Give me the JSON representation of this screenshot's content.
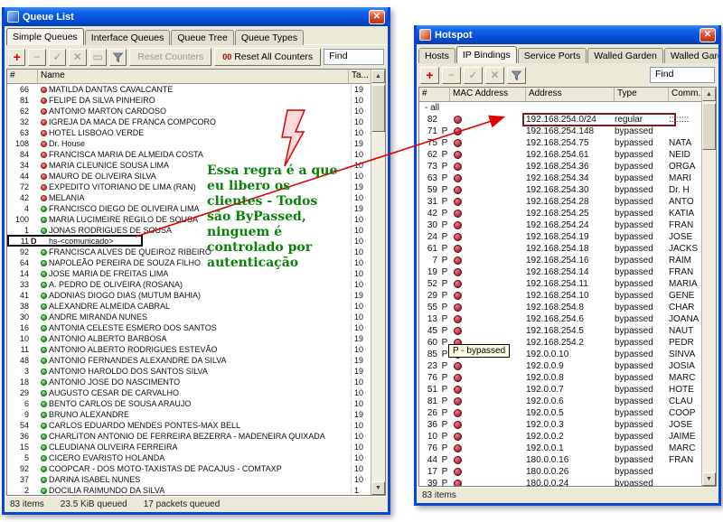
{
  "queue_window": {
    "title": "Queue List",
    "tabs": [
      "Simple Queues",
      "Interface Queues",
      "Queue Tree",
      "Queue Types"
    ],
    "active_tab": 0,
    "toolbar": {
      "reset_counters": "Reset Counters",
      "reset_all_prefix": "00",
      "reset_all": "Reset All Counters",
      "find": "Find"
    },
    "columns": [
      "#",
      "Name",
      "Ta..."
    ],
    "rows": [
      {
        "num": "66",
        "icon": "red",
        "name": "MATILDA DANTAS CAVALCANTE",
        "ta": "19"
      },
      {
        "num": "81",
        "icon": "red",
        "name": "FELIPE DA SILVA PINHEIRO",
        "ta": "10"
      },
      {
        "num": "62",
        "icon": "red",
        "name": "ANTONIO MARTON CARDOSO",
        "ta": "10"
      },
      {
        "num": "32",
        "icon": "red",
        "name": "IGREJA DA MACA DE FRANCA COMPCORO",
        "ta": "10"
      },
      {
        "num": "63",
        "icon": "red",
        "name": "HOTEL LISBOAO VERDE",
        "ta": "10"
      },
      {
        "num": "108",
        "icon": "red",
        "name": "Dr. House",
        "ta": "19"
      },
      {
        "num": "84",
        "icon": "red",
        "name": "FRANCISCA MARIA DE ALMEIDA COSTA",
        "ta": "10"
      },
      {
        "num": "34",
        "icon": "red",
        "name": "MARIA CLEUNICE SOUSA LIMA",
        "ta": "10"
      },
      {
        "num": "44",
        "icon": "red",
        "name": "MAURO DE OLIVEIRA SILVA",
        "ta": "10"
      },
      {
        "num": "72",
        "icon": "red",
        "name": "EXPEDITO VITORIANO DE LIMA (RAN)",
        "ta": "19"
      },
      {
        "num": "42",
        "icon": "red",
        "name": "MELANIA",
        "ta": "10"
      },
      {
        "num": "4",
        "icon": "green",
        "name": "FRANCISCO DIEGO DE OLIVEIRA LIMA",
        "ta": "19"
      },
      {
        "num": "100",
        "icon": "green",
        "name": "MARIA LUCIMEIRE REGILO DE SOUSA",
        "ta": "10"
      },
      {
        "num": "1",
        "icon": "green",
        "name": "JONAS RODRIGUES DE SOUSA",
        "ta": "10"
      },
      {
        "num": "11",
        "flag": "D",
        "name": "hs-<comunicado>",
        "ta": "10",
        "boxed": true
      },
      {
        "num": "92",
        "icon": "green",
        "name": "FRANCISCA ALVES DE QUEIROZ RIBEIRO",
        "ta": "10"
      },
      {
        "num": "64",
        "icon": "green",
        "name": "NAPOLEÃO PEREIRA DE SOUZA FILHO",
        "ta": "10"
      },
      {
        "num": "14",
        "icon": "green",
        "name": "JOSE MARIA DE FREITAS LIMA",
        "ta": "10"
      },
      {
        "num": "33",
        "icon": "green",
        "name": "A. PEDRO DE OLIVEIRA (ROSANA)",
        "ta": "10"
      },
      {
        "num": "41",
        "icon": "green",
        "name": "ADONIAS DIOGO DIAS (MUTUM BAHIA)",
        "ta": "19"
      },
      {
        "num": "38",
        "icon": "green",
        "name": "ALEXANDRE ALMEIDA CABRAL",
        "ta": "10"
      },
      {
        "num": "30",
        "icon": "green",
        "name": "ANDRE MIRANDA NUNES",
        "ta": "10"
      },
      {
        "num": "16",
        "icon": "green",
        "name": "ANTONIA CELESTE ESMERO DOS SANTOS",
        "ta": "10"
      },
      {
        "num": "10",
        "icon": "green",
        "name": "ANTONIO ALBERTO BARBOSA",
        "ta": "19"
      },
      {
        "num": "11",
        "icon": "green",
        "name": "ANTONIO ALBERTO RODRIGUES ESTEVÃO",
        "ta": "10"
      },
      {
        "num": "48",
        "icon": "green",
        "name": "ANTONIO FERNANDES ALEXANDRE DA SILVA",
        "ta": "19"
      },
      {
        "num": "3",
        "icon": "green",
        "name": "ANTONIO HAROLDO DOS SANTOS SILVA",
        "ta": "19"
      },
      {
        "num": "18",
        "icon": "green",
        "name": "ANTONIO JOSE DO NASCIMENTO",
        "ta": "10"
      },
      {
        "num": "29",
        "icon": "green",
        "name": "AUGUSTO CESAR DE CARVALHO",
        "ta": "10"
      },
      {
        "num": "6",
        "icon": "green",
        "name": "BENTO CARLOS DE SOUSA ARAUJO",
        "ta": "10"
      },
      {
        "num": "9",
        "icon": "green",
        "name": "BRUNO ALEXANDRE",
        "ta": "19"
      },
      {
        "num": "54",
        "icon": "green",
        "name": "CARLOS EDUARDO MENDES PONTES-MAX BELL",
        "ta": "10"
      },
      {
        "num": "36",
        "icon": "green",
        "name": "CHARLITON ANTONIO DE FERREIRA BEZERRA - MADENEIRA QUIXADA",
        "ta": "10"
      },
      {
        "num": "15",
        "icon": "green",
        "name": "CLEUDIANA OLIVEIRA FERREIRA",
        "ta": "10"
      },
      {
        "num": "5",
        "icon": "green",
        "name": "CICERO EVARISTO HOLANDA",
        "ta": "10"
      },
      {
        "num": "92",
        "icon": "green",
        "name": "COOPCAR - DOS MOTO-TAXISTAS DE PACAJUS - COMTAXP",
        "ta": "10"
      },
      {
        "num": "37",
        "icon": "green",
        "name": "DARINA ISABEL NUNES",
        "ta": "10"
      },
      {
        "num": "2",
        "icon": "green",
        "name": "DOCILIA RAIMUNDO DA SILVA",
        "ta": "1"
      }
    ],
    "status": [
      "83 items",
      "23.5 KiB queued",
      "17 packets queued"
    ]
  },
  "hotspot_window": {
    "title": "Hotspot",
    "tabs": [
      "Hosts",
      "IP Bindings",
      "Service Ports",
      "Walled Garden",
      "Walled Garden IP List"
    ],
    "active_tab": 1,
    "toolbar": {
      "find": "Find"
    },
    "columns": [
      "#",
      "MAC Address",
      "Address",
      "Type",
      "Comm..."
    ],
    "rows": [
      {
        "group": "all"
      },
      {
        "num": "82",
        "flag": "",
        "addr": "192.168.254.0/24",
        "type": "regular",
        "comment": "::::::::",
        "highlight": true
      },
      {
        "num": "71",
        "flag": "P",
        "addr": "192.168.254.148",
        "type": "bypassed",
        "comment": ""
      },
      {
        "num": "75",
        "flag": "P",
        "addr": "192.168.254.75",
        "type": "bypassed",
        "comment": "NATA"
      },
      {
        "num": "62",
        "flag": "P",
        "addr": "192.168.254.61",
        "type": "bypassed",
        "comment": "NEID"
      },
      {
        "num": "73",
        "flag": "P",
        "addr": "192.168.254.36",
        "type": "bypassed",
        "comment": "ORGA"
      },
      {
        "num": "63",
        "flag": "P",
        "addr": "192.168.254.34",
        "type": "bypassed",
        "comment": "MARI"
      },
      {
        "num": "59",
        "flag": "P",
        "addr": "192.168.254.30",
        "type": "bypassed",
        "comment": "Dr. H"
      },
      {
        "num": "31",
        "flag": "P",
        "addr": "192.168.254.28",
        "type": "bypassed",
        "comment": "ANTO"
      },
      {
        "num": "42",
        "flag": "P",
        "addr": "192.168.254.25",
        "type": "bypassed",
        "comment": "KATIA"
      },
      {
        "num": "30",
        "flag": "P",
        "addr": "192.168.254.24",
        "type": "bypassed",
        "comment": "FRAN"
      },
      {
        "num": "24",
        "flag": "P",
        "addr": "192.168.254.19",
        "type": "bypassed",
        "comment": "JOSE"
      },
      {
        "num": "61",
        "flag": "P",
        "addr": "192.168.254.18",
        "type": "bypassed",
        "comment": "JACKS"
      },
      {
        "num": "7",
        "flag": "P",
        "addr": "192.168.254.16",
        "type": "bypassed",
        "comment": "RAIM"
      },
      {
        "num": "19",
        "flag": "P",
        "addr": "192.168.254.14",
        "type": "bypassed",
        "comment": "FRAN"
      },
      {
        "num": "52",
        "flag": "P",
        "addr": "192.168.254.11",
        "type": "bypassed",
        "comment": "MARIA"
      },
      {
        "num": "29",
        "flag": "P",
        "addr": "192.168.254.10",
        "type": "bypassed",
        "comment": "GENE"
      },
      {
        "num": "55",
        "flag": "P",
        "addr": "192.168.254.8",
        "type": "bypassed",
        "comment": "CHAR"
      },
      {
        "num": "13",
        "flag": "P",
        "addr": "192.168.254.6",
        "type": "bypassed",
        "comment": "JOANA"
      },
      {
        "num": "45",
        "flag": "P",
        "addr": "192.168.254.5",
        "type": "bypassed",
        "comment": "NAUT"
      },
      {
        "num": "60",
        "flag": "P",
        "addr": "192.168.254.2",
        "type": "bypassed",
        "comment": "PEDR"
      },
      {
        "num": "85",
        "flag": "P",
        "addr": "192.0.0.10",
        "type": "bypassed",
        "comment": "SINVA"
      },
      {
        "num": "23",
        "flag": "P",
        "addr": "192.0.0.9",
        "type": "bypassed",
        "comment": "JOSIA"
      },
      {
        "num": "76",
        "flag": "P",
        "addr": "192.0.0.8",
        "type": "bypassed",
        "comment": "MARC"
      },
      {
        "num": "51",
        "flag": "P",
        "addr": "192.0.0.7",
        "type": "bypassed",
        "comment": "HOTE"
      },
      {
        "num": "81",
        "flag": "P",
        "addr": "192.0.0.6",
        "type": "bypassed",
        "comment": "CLAU"
      },
      {
        "num": "26",
        "flag": "P",
        "addr": "192.0.0.5",
        "type": "bypassed",
        "comment": "COOP"
      },
      {
        "num": "36",
        "flag": "P",
        "addr": "192.0.0.3",
        "type": "bypassed",
        "comment": "JOSE"
      },
      {
        "num": "10",
        "flag": "P",
        "addr": "192.0.0.2",
        "type": "bypassed",
        "comment": "JAIME"
      },
      {
        "num": "76",
        "flag": "P",
        "addr": "192.0.0.1",
        "type": "bypassed",
        "comment": "MARC"
      },
      {
        "num": "44",
        "flag": "P",
        "addr": "180.0.0.16",
        "type": "bypassed",
        "comment": "FRAN"
      },
      {
        "num": "17",
        "flag": "P",
        "addr": "180.0.0.26",
        "type": "bypassed",
        "comment": ""
      },
      {
        "num": "39",
        "flag": "P",
        "addr": "180.0.0.24",
        "type": "bypassed",
        "comment": ""
      }
    ],
    "status": "83 items",
    "tooltip": "P - bypassed"
  },
  "annotations": {
    "note": "Essa regra é a que\neu libero os\nclientes - Todos\nsão ByPassed,\nninguem é\ncontrolado por\nautenticação",
    "note_color": "#068206",
    "arrow_color": "#E00000",
    "highlight_box_color": "#7B2020"
  }
}
